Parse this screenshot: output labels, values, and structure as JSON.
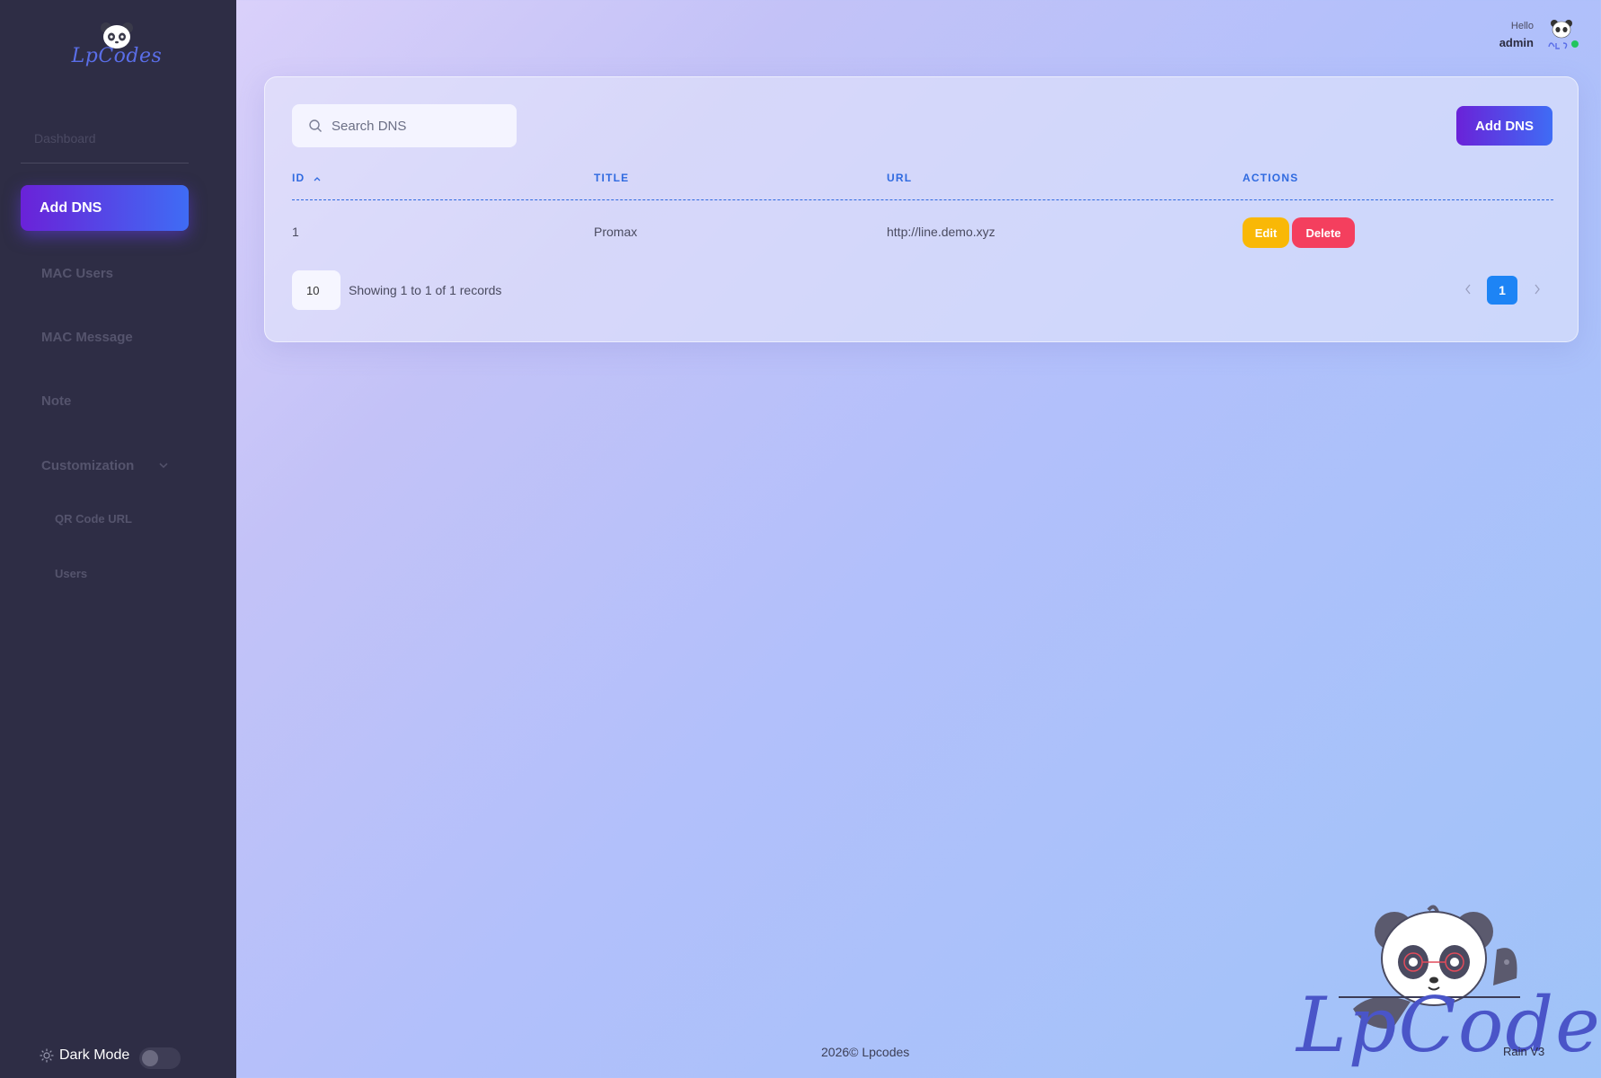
{
  "brand": {
    "logo_text": "LpCodes",
    "accent": "#5a6ee8"
  },
  "sidebar": {
    "dashboard_label": "Dashboard",
    "active_item": "Add DNS",
    "items": [
      {
        "label": "MAC Users"
      },
      {
        "label": "MAC Message"
      },
      {
        "label": "Note"
      },
      {
        "label": "Customization"
      }
    ],
    "sub_items": [
      {
        "label": "QR Code URL"
      },
      {
        "label": "Users"
      }
    ],
    "dark_mode_label": "Dark Mode",
    "dark_mode_on": false
  },
  "header": {
    "greeting": "Hello",
    "username": "admin",
    "status": "online"
  },
  "toolbar": {
    "search_placeholder": "Search DNS",
    "add_label": "Add DNS"
  },
  "table": {
    "columns": [
      "ID",
      "TITLE",
      "URL",
      "ACTIONS"
    ],
    "sort_column": "ID",
    "sort_direction": "ascending",
    "rows": [
      {
        "id": "1",
        "title": "Promax",
        "url": "http://line.demo.xyz",
        "edit": "Edit",
        "delete": "Delete"
      }
    ]
  },
  "pagination": {
    "page_size": "10",
    "summary": "Showing 1 to 1 of 1 records",
    "current_page": "1"
  },
  "footer": {
    "copyright": "2026©  Lpcodes",
    "version": "Rain V3",
    "mascot_text": "LpCodes"
  }
}
